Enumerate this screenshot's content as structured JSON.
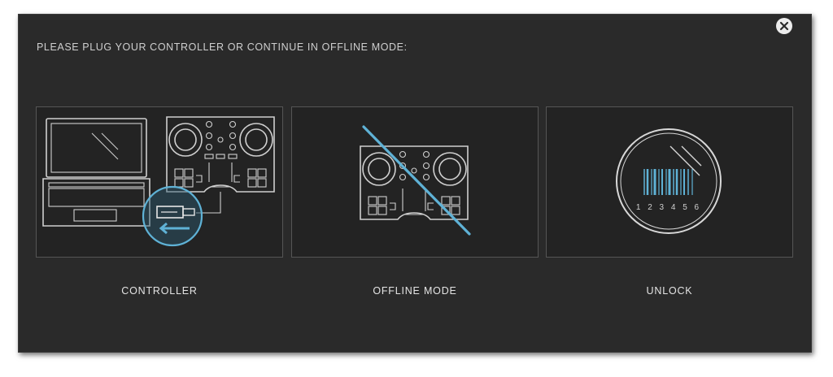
{
  "dialog": {
    "instruction": "PLEASE PLUG YOUR CONTROLLER OR CONTINUE IN OFFLINE MODE:",
    "close_icon": "close-icon",
    "accent_color": "#5fb2d6",
    "background_color": "#2a2a2a"
  },
  "options": [
    {
      "label": "CONTROLLER",
      "icon": "laptop-controller-usb-icon"
    },
    {
      "label": "OFFLINE MODE",
      "icon": "controller-crossed-icon"
    },
    {
      "label": "UNLOCK",
      "icon": "barcode-unlock-icon",
      "code": "1 2 3 4 5 6"
    }
  ]
}
